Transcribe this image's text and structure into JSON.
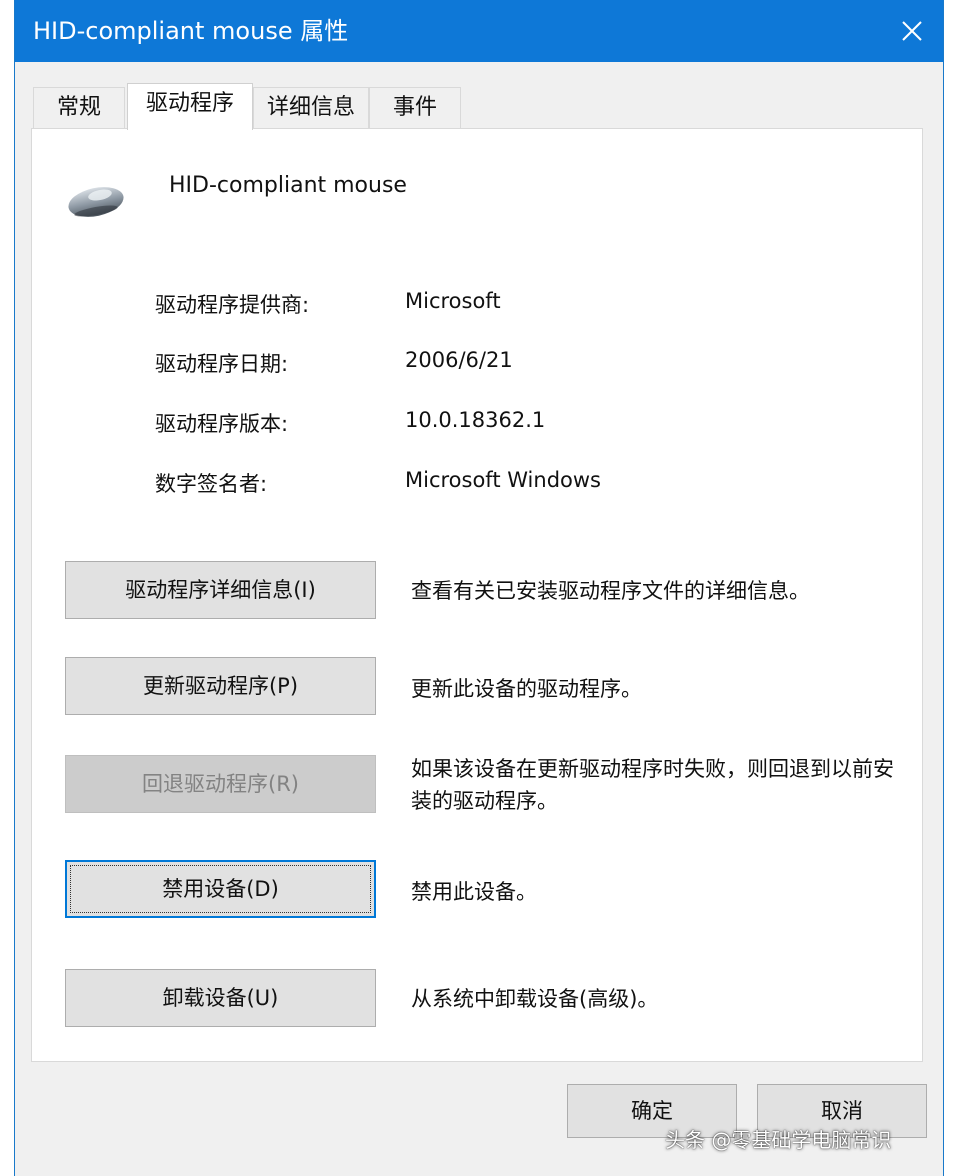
{
  "window": {
    "title": "HID-compliant mouse 属性"
  },
  "tabs": [
    {
      "label": "常规",
      "active": false
    },
    {
      "label": "驱动程序",
      "active": true
    },
    {
      "label": "详细信息",
      "active": false
    },
    {
      "label": "事件",
      "active": false
    }
  ],
  "device": {
    "name": "HID-compliant mouse",
    "icon": "mouse-icon"
  },
  "info": [
    {
      "label": "驱动程序提供商:",
      "value": "Microsoft"
    },
    {
      "label": "驱动程序日期:",
      "value": "2006/6/21"
    },
    {
      "label": "驱动程序版本:",
      "value": "10.0.18362.1"
    },
    {
      "label": "数字签名者:",
      "value": "Microsoft Windows"
    }
  ],
  "actions": [
    {
      "label": "驱动程序详细信息(I)",
      "description": "查看有关已安装驱动程序文件的详细信息。",
      "enabled": true
    },
    {
      "label": "更新驱动程序(P)",
      "description": "更新此设备的驱动程序。",
      "enabled": true
    },
    {
      "label": "回退驱动程序(R)",
      "description": "如果该设备在更新驱动程序时失败，则回退到以前安装的驱动程序。",
      "enabled": false
    },
    {
      "label": "禁用设备(D)",
      "description": "禁用此设备。",
      "enabled": true,
      "focused": true
    },
    {
      "label": "卸载设备(U)",
      "description": "从系统中卸载设备(高级)。",
      "enabled": true
    }
  ],
  "footer": {
    "ok_label": "确定",
    "cancel_label": "取消"
  },
  "watermark": "头条 @零基础学电脑常识",
  "colors": {
    "titlebar": "#0e78d7",
    "focus_border": "#0078d7",
    "button_face": "#e1e1e1",
    "dialog_bg": "#f0f0f0"
  }
}
